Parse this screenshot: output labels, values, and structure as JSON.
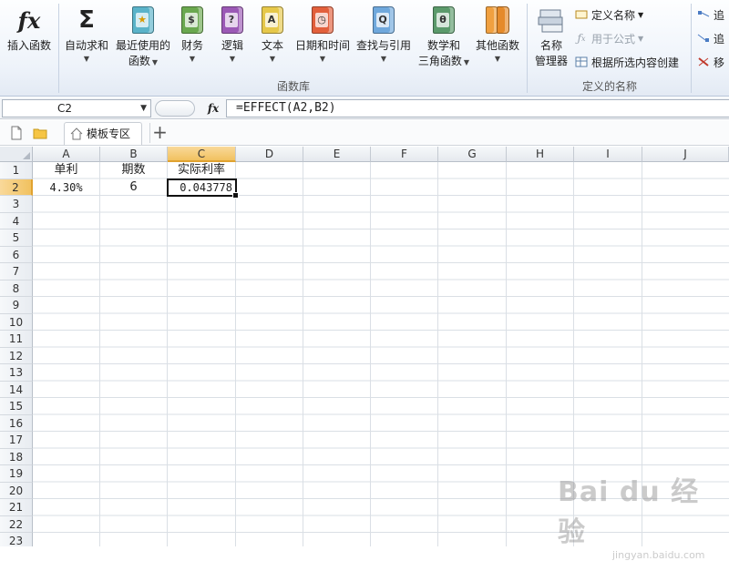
{
  "ribbon": {
    "buttons": {
      "insert_function": "插入函数",
      "autosum": "自动求和",
      "recent_line1": "最近使用的",
      "recent_line2": "函数",
      "financial": "财务",
      "logical": "逻辑",
      "text": "文本",
      "datetime": "日期和时间",
      "lookup": "查找与引用",
      "math_line1": "数学和",
      "math_line2": "三角函数",
      "other": "其他函数",
      "name_manager_line1": "名称",
      "name_manager_line2": "管理器"
    },
    "small_buttons": {
      "define_name": "定义名称",
      "use_in_formula": "用于公式",
      "create_from_selection": "根据所选内容创建",
      "trace_precedents": "追",
      "trace_dependents": "追",
      "remove_arrows": "移"
    },
    "groups": {
      "function_library": "函数库",
      "defined_names": "定义的名称"
    },
    "book_glyphs": {
      "financial": "$",
      "logical": "?",
      "text": "A",
      "lookup": "Q",
      "math": "θ"
    }
  },
  "formula_bar": {
    "name_box": "C2",
    "fx_label": "fx",
    "formula": "=EFFECT(A2,B2)"
  },
  "tabs": {
    "active_tab": "模板专区",
    "add": "+"
  },
  "sheet": {
    "columns": [
      "A",
      "B",
      "C",
      "D",
      "E",
      "F",
      "G",
      "H",
      "I",
      "J"
    ],
    "selected_column": "C",
    "rows": [
      "1",
      "2",
      "3",
      "4",
      "5",
      "6",
      "7",
      "8",
      "9",
      "10",
      "11",
      "12",
      "13",
      "14",
      "15",
      "16",
      "17",
      "18",
      "19",
      "20",
      "21",
      "22",
      "23"
    ],
    "selected_row": "2",
    "cells": {
      "A1": "单利",
      "B1": "期数",
      "C1": "实际利率",
      "A2": "4.30%",
      "B2": "6",
      "C2": "0.043778"
    }
  },
  "watermark": {
    "brand": "Bai du 经验",
    "url": "jingyan.baidu.com"
  },
  "colors": {
    "selection_header": "#f1c15f",
    "ribbon_bg": "#eef3fa",
    "gridline": "#dadfe5"
  }
}
